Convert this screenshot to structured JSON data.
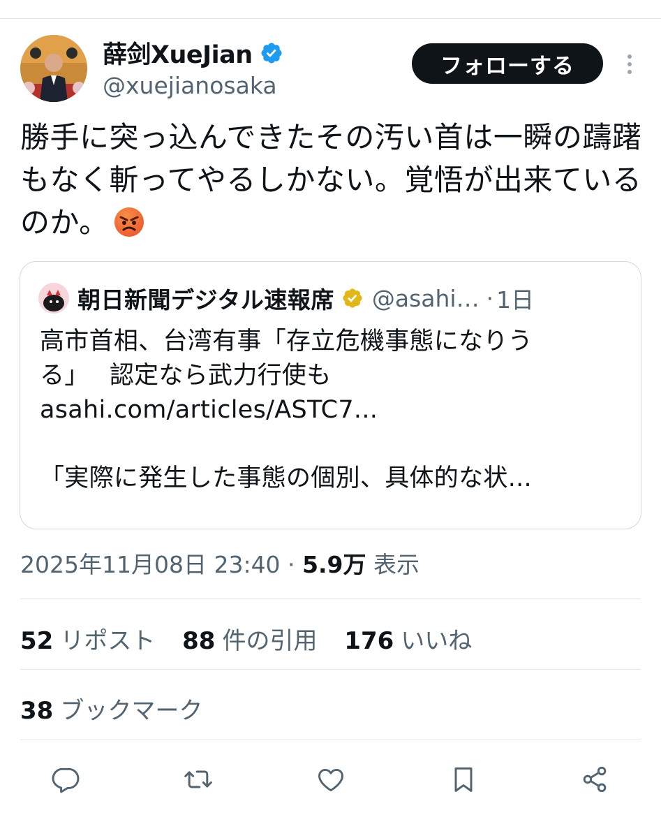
{
  "author": {
    "display_name": "薛剑XueJian",
    "handle": "@xuejianosaka",
    "verified": true
  },
  "follow_button_label": "フォローする",
  "tweet": {
    "text": "勝手に突っ込んできたその汚い首は一瞬の躊躇もなく斬ってやるしかない。覚悟が出来ているのか。",
    "emoji": "angry-face"
  },
  "quote": {
    "name": "朝日新聞デジタル速報席",
    "handle": "@asahi…",
    "dot": "·",
    "time": "1日",
    "lines": [
      "高市首相、台湾有事「存立危機事態になりう",
      "る」　 認定なら武力行使も",
      "asahi.com/articles/ASTC7...",
      "",
      "「実際に発生した事態の個別、具体的な状..."
    ]
  },
  "meta": {
    "datetime": "2025年11月08日 23:40",
    "separator": "·",
    "views_count": "5.9万",
    "views_label": "表示"
  },
  "stats": {
    "reposts": {
      "count": "52",
      "label": "リポスト"
    },
    "quotes": {
      "count": "88",
      "label": "件の引用"
    },
    "likes": {
      "count": "176",
      "label": "いいね"
    },
    "bookmarks": {
      "count": "38",
      "label": "ブックマーク"
    }
  },
  "actions": [
    "reply-icon",
    "repost-icon",
    "like-icon",
    "bookmark-icon",
    "share-icon"
  ],
  "colors": {
    "text": "#0f1419",
    "secondary": "#536471",
    "verified_blue": "#1d9bf0",
    "verified_gold": "#e2b719",
    "border": "#cfd9de"
  }
}
